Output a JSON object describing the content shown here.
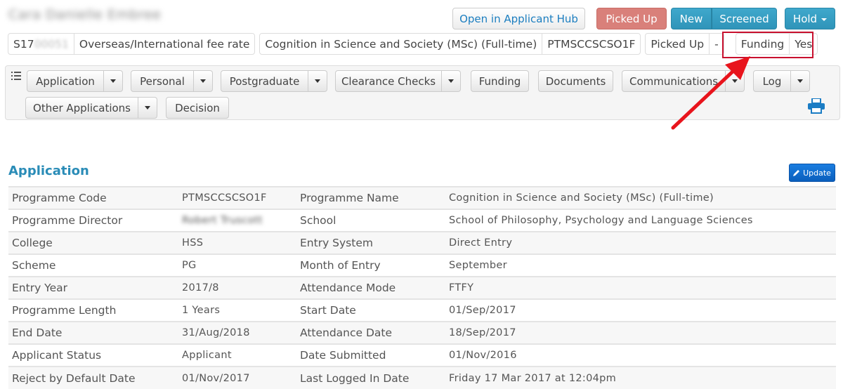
{
  "header": {
    "applicant_name": "Cara Danielle Embree",
    "buttons": {
      "open_hub": "Open in Applicant Hub",
      "picked_up": "Picked Up",
      "new": "New",
      "screened": "Screened",
      "hold": "Hold"
    }
  },
  "summary": {
    "student_id_prefix": "S17",
    "student_id_hidden": "00051",
    "fee_rate": "Overseas/International fee rate",
    "programme_name": "Cognition in Science and Society (MSc) (Full-time)",
    "programme_code": "PTMSCCSCSO1F",
    "status": "Picked Up",
    "status_extra": "-",
    "funding_label": "Funding",
    "funding_value": "Yes"
  },
  "nav": {
    "items": [
      {
        "label": "Application",
        "has_dropdown": true
      },
      {
        "label": "Personal",
        "has_dropdown": true
      },
      {
        "label": "Postgraduate",
        "has_dropdown": true
      },
      {
        "label": "Clearance Checks",
        "has_dropdown": true
      },
      {
        "label": "Funding",
        "has_dropdown": false
      },
      {
        "label": "Documents",
        "has_dropdown": false
      },
      {
        "label": "Communications",
        "has_dropdown": true
      },
      {
        "label": "Log",
        "has_dropdown": true
      },
      {
        "label": "Other Applications",
        "has_dropdown": true
      },
      {
        "label": "Decision",
        "has_dropdown": false
      }
    ],
    "icons": {
      "list": "list-icon",
      "print": "print-icon"
    }
  },
  "section": {
    "title": "Application",
    "update_label": "Update"
  },
  "details": {
    "rows": [
      {
        "l1": "Programme Code",
        "v1": "PTMSCCSCSO1F",
        "l2": "Programme Name",
        "v2": "Cognition in Science and Society (MSc) (Full-time)"
      },
      {
        "l1": "Programme Director",
        "v1": "Robert Truscott",
        "l2": "School",
        "v2": "School of Philosophy, Psychology and Language Sciences"
      },
      {
        "l1": "College",
        "v1": "HSS",
        "l2": "Entry System",
        "v2": "Direct Entry"
      },
      {
        "l1": "Scheme",
        "v1": "PG",
        "l2": "Month of Entry",
        "v2": "September"
      },
      {
        "l1": "Entry Year",
        "v1": "2017/8",
        "l2": "Attendance Mode",
        "v2": "FTFY"
      },
      {
        "l1": "Programme Length",
        "v1": "1 Years",
        "l2": "Start Date",
        "v2": "01/Sep/2017"
      },
      {
        "l1": "End Date",
        "v1": "31/Aug/2018",
        "l2": "Attendance Date",
        "v2": "18/Sep/2017"
      },
      {
        "l1": "Applicant Status",
        "v1": "Applicant",
        "l2": "Date Submitted",
        "v2": "01/Nov/2016"
      },
      {
        "l1": "Reject by Default Date",
        "v1": "01/Nov/2017",
        "l2": "Last Logged In Date",
        "v2": "Friday 17 Mar 2017 at 12:04pm"
      }
    ]
  },
  "colors": {
    "accent": "#2a8cb7",
    "picked_up": "#d9807a",
    "status_blue": "#2f94b9",
    "update_blue": "#0b5fbd",
    "highlight": "#c8102e"
  }
}
